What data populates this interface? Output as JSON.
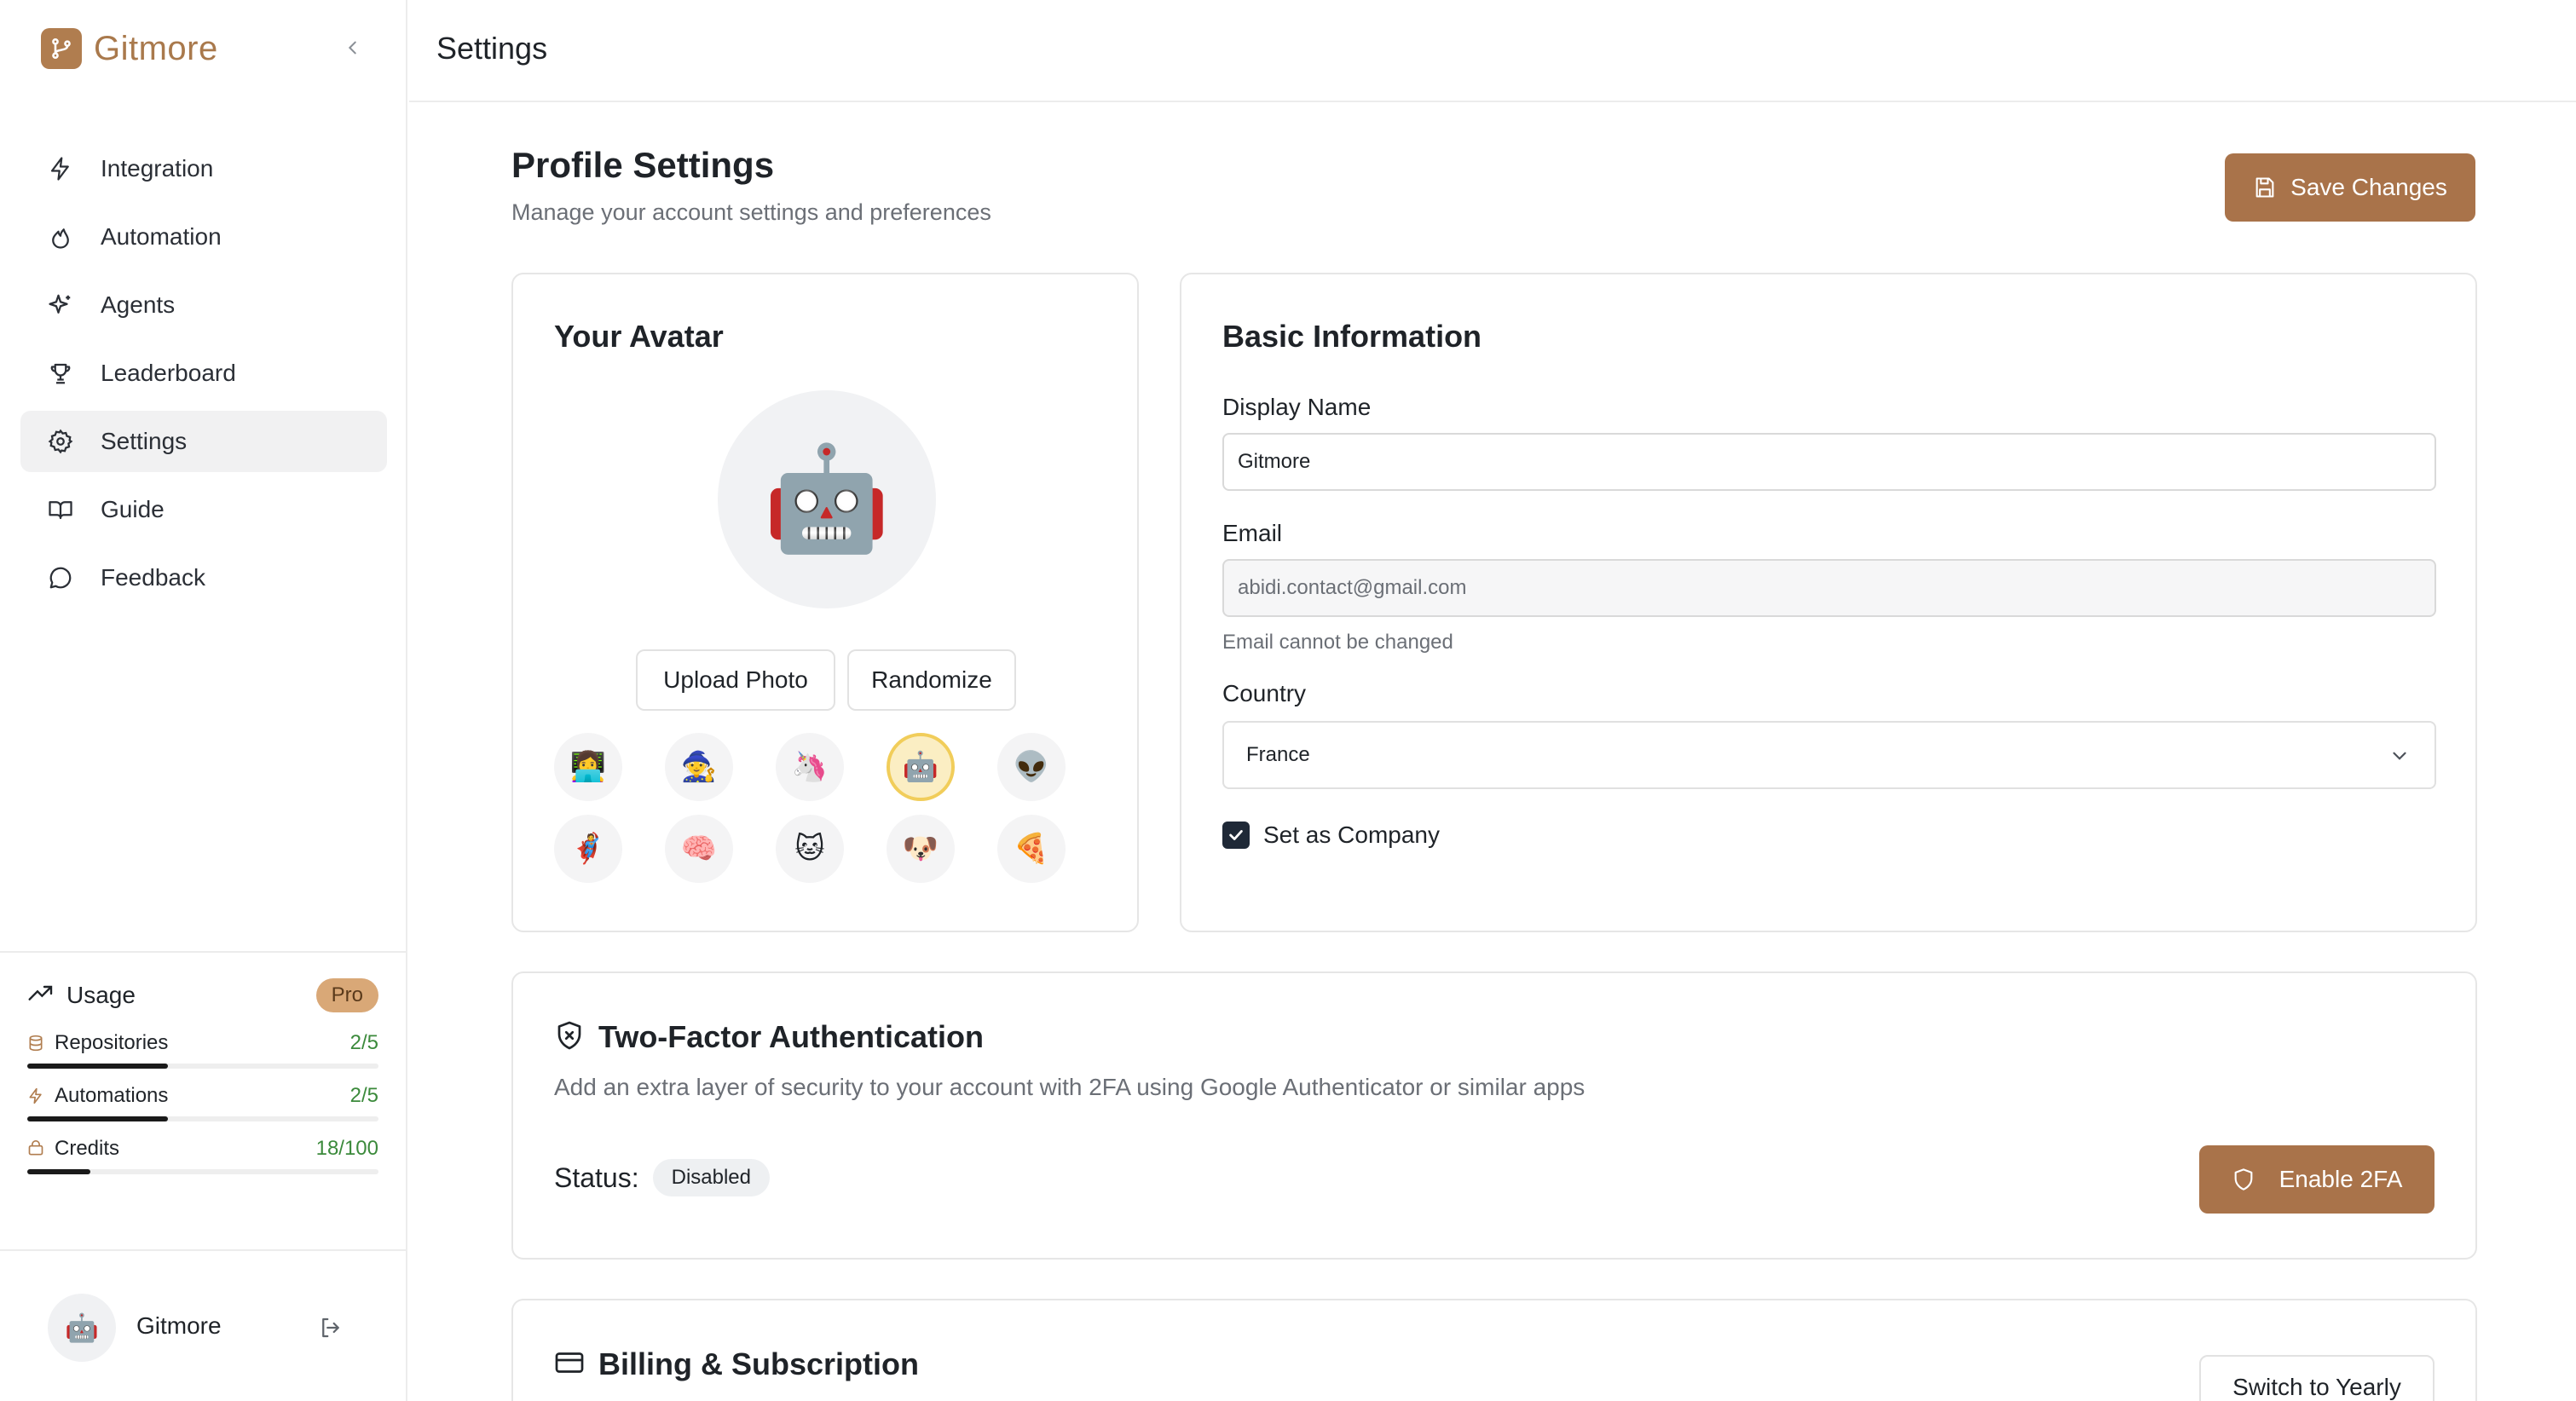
{
  "brand": {
    "name": "Gitmore"
  },
  "nav": [
    {
      "label": "Integration",
      "icon": "zap-icon"
    },
    {
      "label": "Automation",
      "icon": "flame-icon"
    },
    {
      "label": "Agents",
      "icon": "sparkles-icon"
    },
    {
      "label": "Leaderboard",
      "icon": "trophy-icon"
    },
    {
      "label": "Settings",
      "icon": "gear-icon",
      "active": true
    },
    {
      "label": "Guide",
      "icon": "book-icon"
    },
    {
      "label": "Feedback",
      "icon": "message-icon"
    }
  ],
  "usage": {
    "title": "Usage",
    "plan": "Pro",
    "items": [
      {
        "label": "Repositories",
        "value": "2/5",
        "fraction": 0.4
      },
      {
        "label": "Automations",
        "value": "2/5",
        "fraction": 0.4
      },
      {
        "label": "Credits",
        "value": "18/100",
        "fraction": 0.18
      }
    ]
  },
  "user": {
    "name": "Gitmore",
    "avatar": "🤖"
  },
  "header": {
    "title": "Settings"
  },
  "profile": {
    "title": "Profile Settings",
    "subtitle": "Manage your account settings and preferences",
    "save_label": "Save Changes"
  },
  "avatar_card": {
    "title": "Your Avatar",
    "current": "🤖",
    "upload_label": "Upload Photo",
    "randomize_label": "Randomize",
    "options": [
      "👩‍💻",
      "🧙",
      "🦄",
      "🤖",
      "👽",
      "🦸",
      "🧠",
      "🐱",
      "🐶",
      "🍕"
    ],
    "selected_index": 3
  },
  "basic_info": {
    "title": "Basic Information",
    "display_name_label": "Display Name",
    "display_name_value": "Gitmore",
    "email_label": "Email",
    "email_value": "abidi.contact@gmail.com",
    "email_hint": "Email cannot be changed",
    "country_label": "Country",
    "country_value": "France",
    "company_label": "Set as Company",
    "company_checked": true
  },
  "two_factor": {
    "title": "Two-Factor Authentication",
    "description": "Add an extra layer of security to your account with 2FA using Google Authenticator or similar apps",
    "status_label": "Status:",
    "status_value": "Disabled",
    "enable_label": "Enable 2FA"
  },
  "billing": {
    "title": "Billing & Subscription",
    "switch_label": "Switch to Yearly"
  },
  "colors": {
    "accent": "#a9734a",
    "brand": "#a9794c",
    "success": "#3b8a3b"
  }
}
